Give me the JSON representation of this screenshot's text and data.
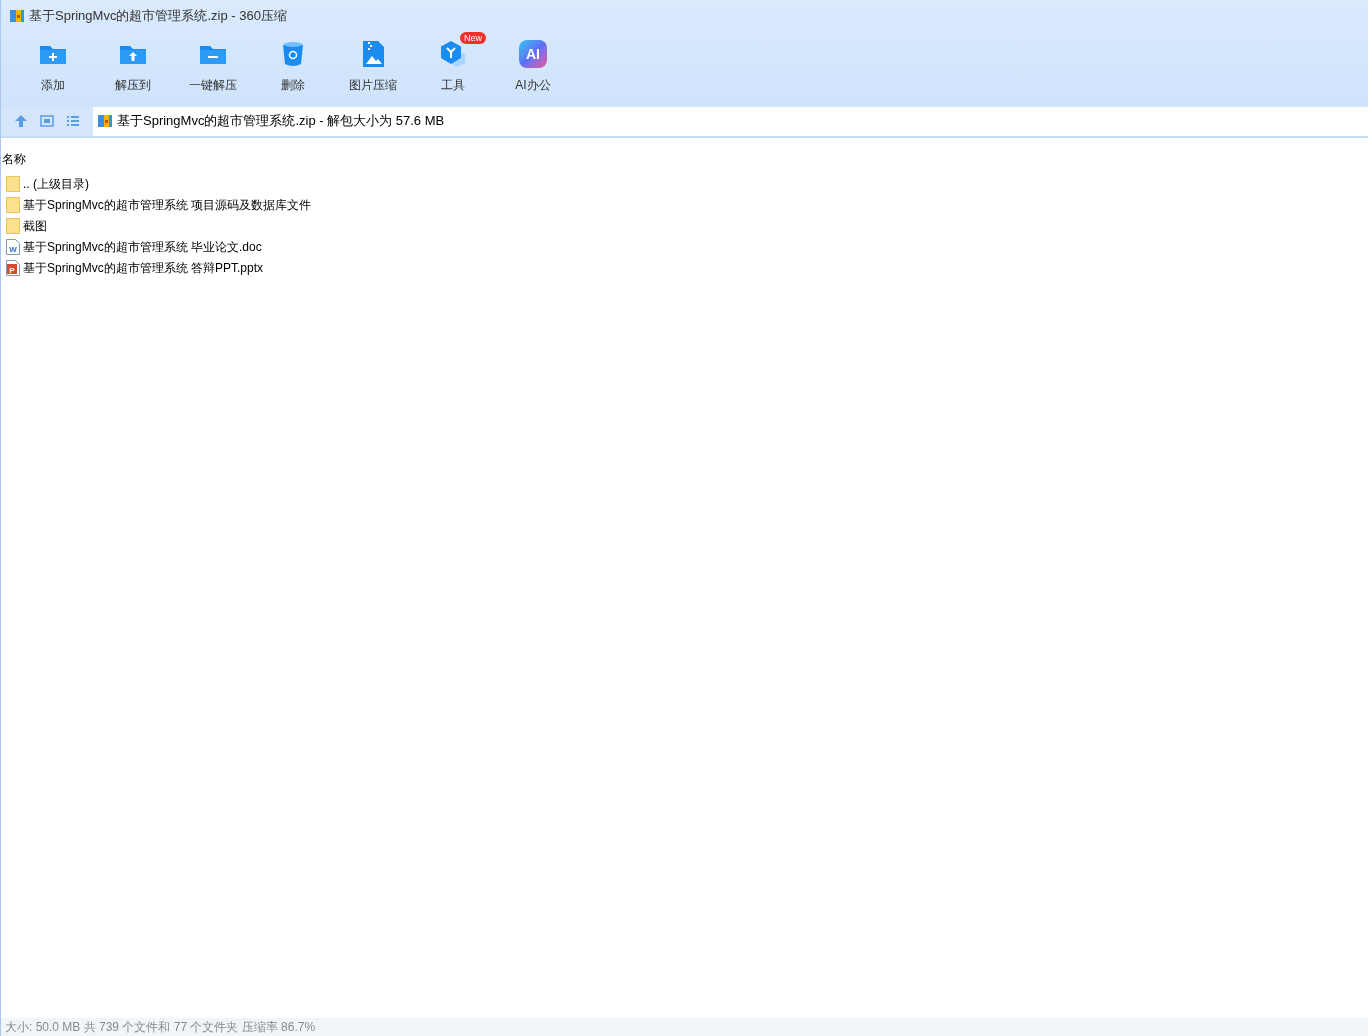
{
  "window": {
    "title": "基于SpringMvc的超市管理系统.zip - 360压缩"
  },
  "toolbar": [
    {
      "kind": "add",
      "label": "添加"
    },
    {
      "kind": "extract",
      "label": "解压到"
    },
    {
      "kind": "quick",
      "label": "一键解压"
    },
    {
      "kind": "delete",
      "label": "删除"
    },
    {
      "kind": "image",
      "label": "图片压缩"
    },
    {
      "kind": "tools",
      "label": "工具",
      "badge": "New"
    },
    {
      "kind": "ai",
      "label": "AI办公",
      "icon_text": "AI"
    }
  ],
  "address": {
    "path": "基于SpringMvc的超市管理系统.zip - 解包大小为 57.6 MB"
  },
  "file_list": {
    "column": "名称",
    "rows": [
      {
        "kind": "parent",
        "name": ".. (上级目录)"
      },
      {
        "kind": "folder",
        "name": "基于SpringMvc的超市管理系统 项目源码及数据库文件"
      },
      {
        "kind": "folder",
        "name": "截图"
      },
      {
        "kind": "doc",
        "name": "基于SpringMvc的超市管理系统 毕业论文.doc",
        "icon_text": "W"
      },
      {
        "kind": "ppt",
        "name": "基于SpringMvc的超市管理系统 答辩PPT.pptx",
        "icon_text": "P"
      }
    ]
  },
  "status_bar": "大小: 50.0 MB 共 739 个文件和 77 个文件夹 压缩率 86.7%"
}
